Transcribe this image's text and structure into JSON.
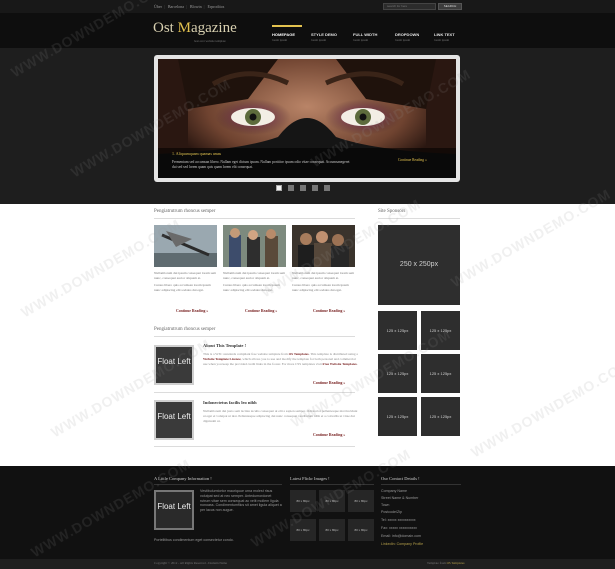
{
  "topbar": {
    "links": [
      "Über",
      "Barcelona",
      "Blowin",
      "Erproditos"
    ],
    "search_placeholder": "search for here",
    "search_button": "SEARCH"
  },
  "header": {
    "logo_main": "Ost ",
    "logo_accent": "M",
    "logo_rest": "agazine",
    "tagline": "best ever website template",
    "nav": [
      {
        "label": "HOMEPAGE",
        "sub": "lorem ipsum"
      },
      {
        "label": "STYLE DEMO",
        "sub": "lorem ipsum"
      },
      {
        "label": "FULL WIDTH",
        "sub": "lorem ipsum"
      },
      {
        "label": "DROPDOWN",
        "sub": "lorem ipsum"
      },
      {
        "label": "LINK TEXT",
        "sub": "lorem ipsum"
      }
    ]
  },
  "slider": {
    "title": "1. Aliquamquam quamas amas",
    "text": "Fermentum sed accumsan libero. Nullam eget dictum ipsum. Nullam porttitor ipsum odio vitae consequat. Accumsanegeret dui sed sed lorem quam quis quam lorem elit consequat.",
    "more": "Continue Reading »",
    "dots": 5,
    "active_dot": 0
  },
  "main": {
    "section1_title": "Pengiatrutrum rhoncus semper",
    "columns": [
      {
        "text1": "Nullamlorum dui ipsum consequat lorem sem nunc, consequat auctor aliquam at.",
        "text2": "Cursus libero quis accumsan lorem ipsum nunc adipiscing elit sodales dui eget.",
        "more": "Continue Reading »"
      },
      {
        "text1": "Nullamlorum dui ipsum consequat lorem sem nunc, consequat auctor aliquam at.",
        "text2": "Cursus libero quis accumsan lorem ipsum nunc adipiscing elit sodales dui eget.",
        "more": "Continue Reading »"
      },
      {
        "text1": "Nullamlorum dui ipsum consequat lorem sem nunc, consequat auctor aliquam at.",
        "text2": "Cursus libero quis accumsan lorem ipsum nunc adipiscing elit sodales dui eget.",
        "more": "Continue Reading »"
      }
    ],
    "section2_title": "Pengiatrutrum rhoncus semper",
    "posts": [
      {
        "float_label": "Float Left",
        "title": "About This Template !",
        "text_a": "This is a W3C standards compliant free website template from ",
        "link1": "OS Templates",
        "text_b": ". This template is distributed using a ",
        "link2": "Website Template Licence",
        "text_c": ", which allows you to use and modify the template for both personal and commercial use when you keep the provided credit links in the footer. For more CSS templates visit ",
        "link3": "Free Website Templates",
        "text_d": ".",
        "more": "Continue Reading »"
      },
      {
        "float_label": "Float Left",
        "title": "Indonectetus facilis leo nibh",
        "text": "Nullamlorem dui justo sem lacinia iaculis consequat ut elit a sapien semper. Odiotortor pellentesque nisi tincidunt ut eget et volutpat ut nisi. Pellentesque adipiscing dui nunc consequat vestibulum nibh et a convallis ut vitae dui dignissim ut.",
        "more": "Continue Reading »"
      }
    ]
  },
  "sidebar": {
    "title": "Site Sponsors",
    "big_ad": "250 x 250px",
    "small_ads": [
      "125 x 125px",
      "125 x 125px",
      "125 x 125px",
      "125 x 125px",
      "125 x 125px",
      "125 x 125px"
    ]
  },
  "footer": {
    "col1_title": "A Little Company Information !",
    "col1_float": "Float Left",
    "col1_text": "Vestibulumtortor mauriquue urna molest risus volutpat sed at nec semper. Antedumordonet rutrum vitae sem consequat ac velit mollem ligula nonoass. Condimentumflics sit amet ligula aliquet a per lacus non augue.",
    "col1_text2": "Portelltibus condimentum eget consectetur condo.",
    "col2_title": "Latest Flickr Images !",
    "flickr": [
      "80 x 80px",
      "80 x 80px",
      "80 x 80px",
      "80 x 80px",
      "80 x 80px",
      "80 x 80px"
    ],
    "col3_title": "Our Contact Details !",
    "contact": [
      "Company Name",
      "Street Name & Number",
      "Town",
      "Postcode/Zip",
      "Tel: xxxxx xxxxxxxxxx",
      "Fax: xxxxx xxxxxxxxxx",
      "Email: info@domain.com",
      "LinkedIn: Company Profile"
    ],
    "copyright": "Copyright © 2012 - All Rights Reserved - Domain Name",
    "credit": "Template from ",
    "credit_link": "OS Templates"
  },
  "watermark": "WWW.DOWNDEMO.COM",
  "colors": {
    "accent": "#e3c24f",
    "link": "#7a2424",
    "dark": "#111111"
  }
}
